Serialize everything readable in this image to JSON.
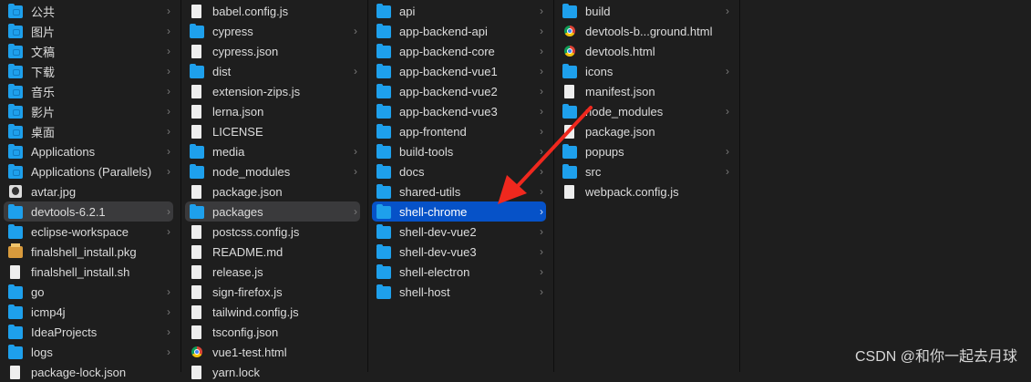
{
  "columns": [
    {
      "items": [
        {
          "name": "公共",
          "type": "special",
          "chevron": true
        },
        {
          "name": "图片",
          "type": "special",
          "chevron": true
        },
        {
          "name": "文稿",
          "type": "special",
          "chevron": true
        },
        {
          "name": "下载",
          "type": "special",
          "chevron": true
        },
        {
          "name": "音乐",
          "type": "special",
          "chevron": true
        },
        {
          "name": "影片",
          "type": "special",
          "chevron": true
        },
        {
          "name": "桌面",
          "type": "special",
          "chevron": true
        },
        {
          "name": "Applications",
          "type": "special",
          "chevron": true
        },
        {
          "name": "Applications (Parallels)",
          "type": "special",
          "chevron": true
        },
        {
          "name": "avtar.jpg",
          "type": "image",
          "chevron": false
        },
        {
          "name": "devtools-6.2.1",
          "type": "folder",
          "chevron": true,
          "selected": "grey"
        },
        {
          "name": "eclipse-workspace",
          "type": "folder",
          "chevron": true
        },
        {
          "name": "finalshell_install.pkg",
          "type": "pkg",
          "chevron": false
        },
        {
          "name": "finalshell_install.sh",
          "type": "file",
          "chevron": false
        },
        {
          "name": "go",
          "type": "folder",
          "chevron": true
        },
        {
          "name": "icmp4j",
          "type": "folder",
          "chevron": true
        },
        {
          "name": "IdeaProjects",
          "type": "folder",
          "chevron": true
        },
        {
          "name": "logs",
          "type": "folder",
          "chevron": true
        },
        {
          "name": "package-lock.json",
          "type": "file",
          "chevron": false
        }
      ]
    },
    {
      "items": [
        {
          "name": "babel.config.js",
          "type": "file",
          "chevron": false
        },
        {
          "name": "cypress",
          "type": "folder",
          "chevron": true
        },
        {
          "name": "cypress.json",
          "type": "file",
          "chevron": false
        },
        {
          "name": "dist",
          "type": "folder",
          "chevron": true
        },
        {
          "name": "extension-zips.js",
          "type": "file",
          "chevron": false
        },
        {
          "name": "lerna.json",
          "type": "file",
          "chevron": false
        },
        {
          "name": "LICENSE",
          "type": "file",
          "chevron": false
        },
        {
          "name": "media",
          "type": "folder",
          "chevron": true
        },
        {
          "name": "node_modules",
          "type": "folder",
          "chevron": true
        },
        {
          "name": "package.json",
          "type": "file",
          "chevron": false
        },
        {
          "name": "packages",
          "type": "folder",
          "chevron": true,
          "selected": "grey"
        },
        {
          "name": "postcss.config.js",
          "type": "file",
          "chevron": false
        },
        {
          "name": "README.md",
          "type": "file",
          "chevron": false
        },
        {
          "name": "release.js",
          "type": "file",
          "chevron": false
        },
        {
          "name": "sign-firefox.js",
          "type": "file",
          "chevron": false
        },
        {
          "name": "tailwind.config.js",
          "type": "file",
          "chevron": false
        },
        {
          "name": "tsconfig.json",
          "type": "file",
          "chevron": false
        },
        {
          "name": "vue1-test.html",
          "type": "chrome",
          "chevron": false
        },
        {
          "name": "yarn.lock",
          "type": "file",
          "chevron": false
        }
      ]
    },
    {
      "items": [
        {
          "name": "api",
          "type": "folder",
          "chevron": true
        },
        {
          "name": "app-backend-api",
          "type": "folder",
          "chevron": true
        },
        {
          "name": "app-backend-core",
          "type": "folder",
          "chevron": true
        },
        {
          "name": "app-backend-vue1",
          "type": "folder",
          "chevron": true
        },
        {
          "name": "app-backend-vue2",
          "type": "folder",
          "chevron": true
        },
        {
          "name": "app-backend-vue3",
          "type": "folder",
          "chevron": true
        },
        {
          "name": "app-frontend",
          "type": "folder",
          "chevron": true
        },
        {
          "name": "build-tools",
          "type": "folder",
          "chevron": true
        },
        {
          "name": "docs",
          "type": "folder",
          "chevron": true
        },
        {
          "name": "shared-utils",
          "type": "folder",
          "chevron": true
        },
        {
          "name": "shell-chrome",
          "type": "folder",
          "chevron": true,
          "selected": "blue"
        },
        {
          "name": "shell-dev-vue2",
          "type": "folder",
          "chevron": true
        },
        {
          "name": "shell-dev-vue3",
          "type": "folder",
          "chevron": true
        },
        {
          "name": "shell-electron",
          "type": "folder",
          "chevron": true
        },
        {
          "name": "shell-host",
          "type": "folder",
          "chevron": true
        }
      ]
    },
    {
      "items": [
        {
          "name": "build",
          "type": "folder",
          "chevron": true
        },
        {
          "name": "devtools-b...ground.html",
          "type": "chrome",
          "chevron": false
        },
        {
          "name": "devtools.html",
          "type": "chrome",
          "chevron": false
        },
        {
          "name": "icons",
          "type": "folder",
          "chevron": true
        },
        {
          "name": "manifest.json",
          "type": "file",
          "chevron": false
        },
        {
          "name": "node_modules",
          "type": "folder",
          "chevron": true
        },
        {
          "name": "package.json",
          "type": "file",
          "chevron": false
        },
        {
          "name": "popups",
          "type": "folder",
          "chevron": true
        },
        {
          "name": "src",
          "type": "folder",
          "chevron": true
        },
        {
          "name": "webpack.config.js",
          "type": "file",
          "chevron": false
        }
      ]
    }
  ],
  "chevron_glyph": "›",
  "watermark": "CSDN @和你一起去月球",
  "colors": {
    "selected_blue": "#0652c8",
    "selected_grey": "#3a3a3c",
    "annotation_arrow": "#f0281e"
  }
}
